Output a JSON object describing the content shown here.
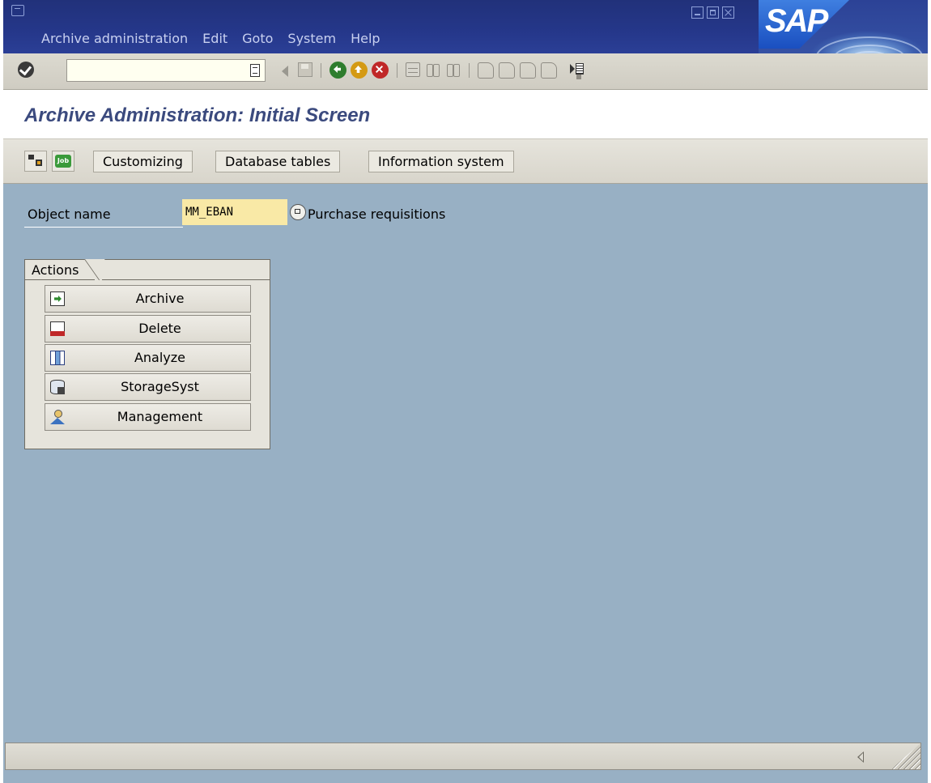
{
  "window": {
    "menu": [
      {
        "label": "Archive administration"
      },
      {
        "label": "Edit"
      },
      {
        "label": "Goto"
      },
      {
        "label": "System"
      },
      {
        "label": "Help"
      }
    ],
    "logo_text": "SAP"
  },
  "toolbar": {
    "command_field_value": "",
    "icons": [
      "enter-icon",
      "command-history-icon",
      "back-arrow-icon",
      "save-icon",
      "back-icon",
      "exit-icon",
      "cancel-icon",
      "print-icon",
      "find-icon",
      "find-next-icon",
      "first-page-icon",
      "previous-page-icon",
      "next-page-icon",
      "last-page-icon",
      "layout-menu-icon"
    ]
  },
  "page": {
    "title": "Archive Administration: Initial Screen"
  },
  "app_toolbar": {
    "buttons": [
      {
        "label": "Customizing"
      },
      {
        "label": "Database tables"
      },
      {
        "label": "Information system"
      }
    ]
  },
  "form": {
    "object_name_label": "Object name",
    "object_name_value": "MM_EBAN",
    "object_description": "Purchase requisitions"
  },
  "actions": {
    "title": "Actions",
    "buttons": [
      {
        "label": "Archive",
        "icon": "archive-icon"
      },
      {
        "label": "Delete",
        "icon": "delete-icon"
      },
      {
        "label": "Analyze",
        "icon": "analyze-icon"
      },
      {
        "label": "StorageSyst",
        "icon": "storage-system-icon"
      },
      {
        "label": "Management",
        "icon": "management-icon"
      }
    ]
  },
  "colors": {
    "menubar": "#25378a",
    "content_background": "#98b0c4",
    "title_text": "#3b4a7e",
    "input_highlight": "#f9e9a6"
  }
}
